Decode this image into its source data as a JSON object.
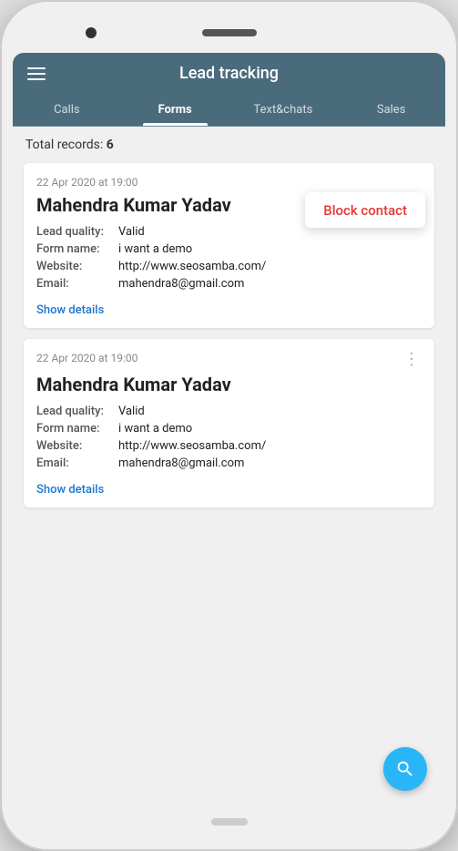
{
  "app": {
    "title": "Lead tracking",
    "hamburger_label": "menu"
  },
  "tabs": [
    {
      "id": "calls",
      "label": "Calls",
      "active": false
    },
    {
      "id": "forms",
      "label": "Forms",
      "active": true
    },
    {
      "id": "text_chats",
      "label": "Text&chats",
      "active": false
    },
    {
      "id": "sales",
      "label": "Sales",
      "active": false
    }
  ],
  "content": {
    "total_records_label": "Total records:",
    "total_records_value": "6",
    "block_contact_label": "Block contact",
    "records": [
      {
        "date": "22 Apr 2020 at 19:00",
        "name": "Mahendra Kumar Yadav",
        "lead_quality_label": "Lead quality:",
        "lead_quality_value": "Valid",
        "form_name_label": "Form name:",
        "form_name_value": "i want a demo",
        "website_label": "Website:",
        "website_value": "http://www.seosamba.com/",
        "email_label": "Email:",
        "email_value": "mahendra8@gmail.com",
        "show_details_label": "Show details",
        "has_popup": true,
        "has_dots": false
      },
      {
        "date": "22 Apr 2020 at 19:00",
        "name": "Mahendra Kumar Yadav",
        "lead_quality_label": "Lead quality:",
        "lead_quality_value": "Valid",
        "form_name_label": "Form name:",
        "form_name_value": "i want a demo",
        "website_label": "Website:",
        "website_value": "http://www.seosamba.com/",
        "email_label": "Email:",
        "email_value": "mahendra8@gmail.com",
        "show_details_label": "Show details",
        "has_popup": false,
        "has_dots": true
      }
    ]
  },
  "fab": {
    "label": "search"
  }
}
